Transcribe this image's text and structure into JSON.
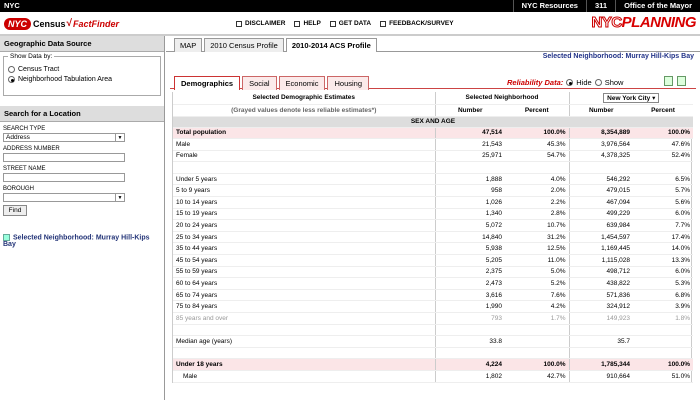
{
  "topbar": {
    "nyc": "NYC",
    "links": [
      "NYC Resources",
      "311",
      "Office of the Mayor"
    ]
  },
  "header": {
    "logo_nyc": "NYC",
    "logo_census": "Census",
    "logo_check": "√",
    "logo_ff": "FactFinder",
    "nav": [
      "DISCLAIMER",
      "HELP",
      "GET DATA",
      "FEEDBACK/SURVEY"
    ],
    "brand_nyc": "NYC",
    "brand_planning": "PLANNING"
  },
  "sidebar": {
    "geo_header": "Geographic Data Source",
    "show_by_label": "Show Data by:",
    "option_tract": "Census Tract",
    "option_nta": "Neighborhood Tabulation Area",
    "search_header": "Search for a Location",
    "search_type_label": "SEARCH TYPE",
    "search_type_value": "Address",
    "address_label": "ADDRESS NUMBER",
    "street_label": "STREET NAME",
    "borough_label": "BOROUGH",
    "find_label": "Find",
    "legend_text": "Selected Neighborhood: Murray Hill-Kips Bay"
  },
  "main": {
    "tabs": [
      "MAP",
      "2010 Census Profile",
      "2010-2014 ACS Profile"
    ],
    "selected_nb": "Selected Neighborhood: Murray Hill-Kips Bay",
    "subtabs": [
      "Demographics",
      "Social",
      "Economic",
      "Housing"
    ],
    "reliability_label": "Reliability Data:",
    "hide_label": "Hide",
    "show_label": "Show"
  },
  "table": {
    "hdr_estimates": "Selected Demographic Estimates",
    "hdr_grayed": "(Grayed values denote less reliable estimates*)",
    "hdr_selected": "Selected Neighborhood",
    "hdr_nyc": "New York City",
    "col_number": "Number",
    "col_percent": "Percent",
    "section": "SEX AND AGE",
    "rows": [
      {
        "label": "Total population",
        "n1": "47,514",
        "p1": "100.0%",
        "n2": "8,354,889",
        "p2": "100.0%",
        "style": "emph"
      },
      {
        "label": "Male",
        "n1": "21,543",
        "p1": "45.3%",
        "n2": "3,976,564",
        "p2": "47.6%",
        "style": ""
      },
      {
        "label": "Female",
        "n1": "25,971",
        "p1": "54.7%",
        "n2": "4,378,325",
        "p2": "52.4%",
        "style": ""
      },
      {
        "label": "",
        "n1": "",
        "p1": "",
        "n2": "",
        "p2": "",
        "style": "blank"
      },
      {
        "label": "Under 5 years",
        "n1": "1,888",
        "p1": "4.0%",
        "n2": "546,292",
        "p2": "6.5%",
        "style": ""
      },
      {
        "label": "5 to 9 years",
        "n1": "958",
        "p1": "2.0%",
        "n2": "479,015",
        "p2": "5.7%",
        "style": ""
      },
      {
        "label": "10 to 14 years",
        "n1": "1,026",
        "p1": "2.2%",
        "n2": "467,094",
        "p2": "5.6%",
        "style": ""
      },
      {
        "label": "15 to 19 years",
        "n1": "1,340",
        "p1": "2.8%",
        "n2": "499,229",
        "p2": "6.0%",
        "style": ""
      },
      {
        "label": "20 to 24 years",
        "n1": "5,072",
        "p1": "10.7%",
        "n2": "639,984",
        "p2": "7.7%",
        "style": ""
      },
      {
        "label": "25 to 34 years",
        "n1": "14,840",
        "p1": "31.2%",
        "n2": "1,454,597",
        "p2": "17.4%",
        "style": ""
      },
      {
        "label": "35 to 44 years",
        "n1": "5,938",
        "p1": "12.5%",
        "n2": "1,169,445",
        "p2": "14.0%",
        "style": ""
      },
      {
        "label": "45 to 54 years",
        "n1": "5,205",
        "p1": "11.0%",
        "n2": "1,115,028",
        "p2": "13.3%",
        "style": ""
      },
      {
        "label": "55 to 59 years",
        "n1": "2,375",
        "p1": "5.0%",
        "n2": "498,712",
        "p2": "6.0%",
        "style": ""
      },
      {
        "label": "60 to 64 years",
        "n1": "2,473",
        "p1": "5.2%",
        "n2": "438,822",
        "p2": "5.3%",
        "style": ""
      },
      {
        "label": "65 to 74 years",
        "n1": "3,616",
        "p1": "7.6%",
        "n2": "571,836",
        "p2": "6.8%",
        "style": ""
      },
      {
        "label": "75 to 84 years",
        "n1": "1,990",
        "p1": "4.2%",
        "n2": "324,912",
        "p2": "3.9%",
        "style": ""
      },
      {
        "label": "85 years and over",
        "n1": "793",
        "p1": "1.7%",
        "n2": "149,923",
        "p2": "1.8%",
        "style": "grey"
      },
      {
        "label": "",
        "n1": "",
        "p1": "",
        "n2": "",
        "p2": "",
        "style": "blank"
      },
      {
        "label": "Median age (years)",
        "n1": "33.8",
        "p1": "",
        "n2": "35.7",
        "p2": "",
        "style": ""
      },
      {
        "label": "",
        "n1": "",
        "p1": "",
        "n2": "",
        "p2": "",
        "style": "blank"
      },
      {
        "label": "Under 18 years",
        "n1": "4,224",
        "p1": "100.0%",
        "n2": "1,785,344",
        "p2": "100.0%",
        "style": "emph"
      },
      {
        "label": "Male",
        "n1": "1,802",
        "p1": "42.7%",
        "n2": "910,664",
        "p2": "51.0%",
        "style": "indent"
      }
    ]
  }
}
